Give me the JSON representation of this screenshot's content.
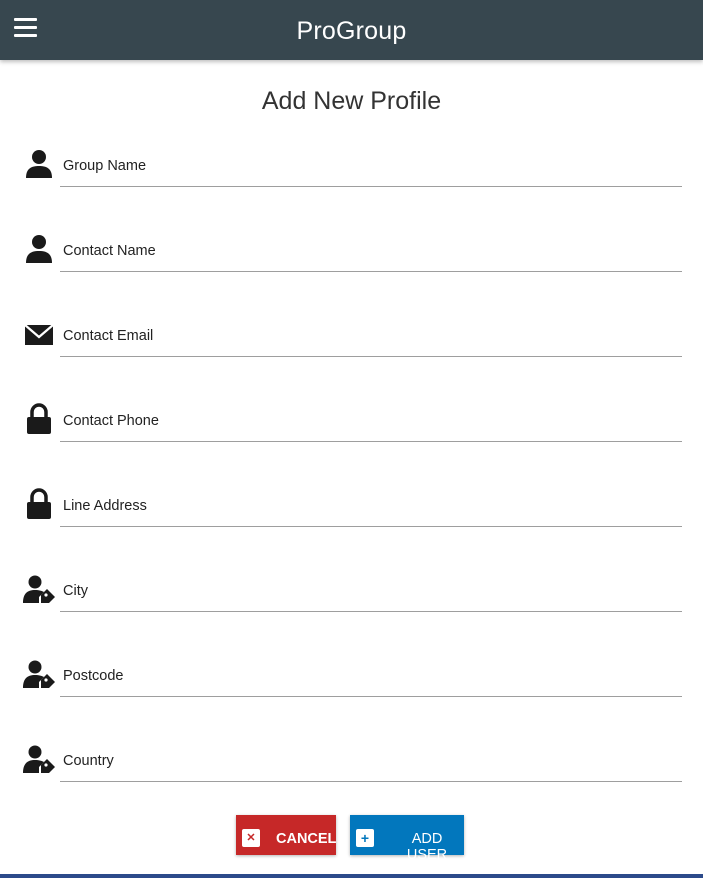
{
  "header": {
    "app_title": "ProGroup",
    "menu_icon": "hamburger-menu-icon",
    "background": "#37474f"
  },
  "page": {
    "title": "Add New Profile"
  },
  "form": {
    "fields": [
      {
        "label": "Group Name",
        "icon": "person-icon",
        "value": ""
      },
      {
        "label": "Contact Name",
        "icon": "person-icon",
        "value": ""
      },
      {
        "label": "Contact Email",
        "icon": "envelope-icon",
        "value": ""
      },
      {
        "label": "Contact Phone",
        "icon": "lock-icon",
        "value": ""
      },
      {
        "label": "Line Address",
        "icon": "lock-icon",
        "value": ""
      },
      {
        "label": "City",
        "icon": "person-tag-icon",
        "value": ""
      },
      {
        "label": "Postcode",
        "icon": "person-tag-icon",
        "value": ""
      },
      {
        "label": "Country",
        "icon": "person-tag-icon",
        "value": ""
      }
    ]
  },
  "actions": {
    "cancel_label": "CANCEL",
    "cancel_icon": "close-icon",
    "cancel_color": "#c62828",
    "add_label": "ADD USER",
    "add_icon": "plus-icon",
    "add_color": "#0277bd"
  }
}
